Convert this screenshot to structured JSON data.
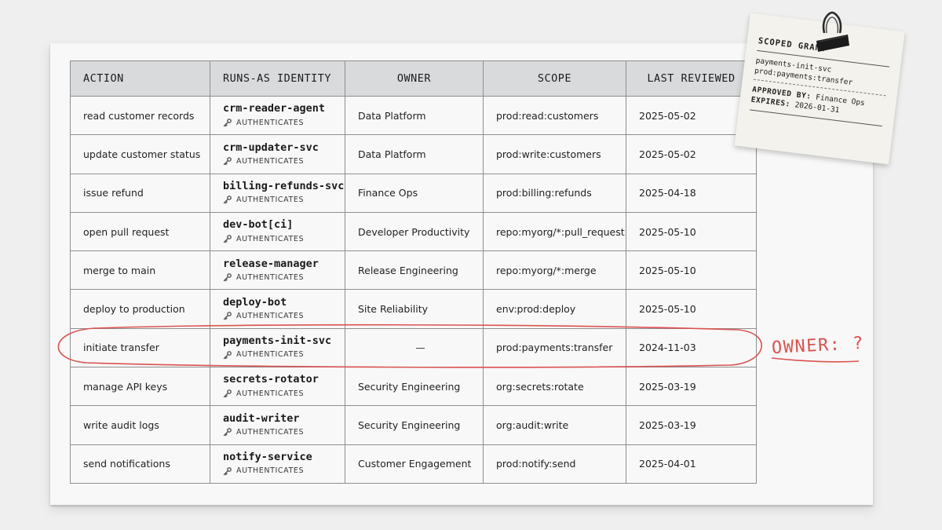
{
  "table": {
    "headers": {
      "action": "ACTION",
      "identity": "RUNS-AS IDENTITY",
      "owner": "OWNER",
      "scope": "SCOPE",
      "reviewed": "LAST REVIEWED"
    },
    "rows": [
      {
        "action": "read customer records",
        "identity": "crm-reader-agent",
        "auth": "AUTHENTICATES",
        "owner": "Data Platform",
        "scope": "prod:read:customers",
        "reviewed": "2025-05-02"
      },
      {
        "action": "update customer status",
        "identity": "crm-updater-svc",
        "auth": "AUTHENTICATES",
        "owner": "Data Platform",
        "scope": "prod:write:customers",
        "reviewed": "2025-05-02"
      },
      {
        "action": "issue refund",
        "identity": "billing-refunds-svc",
        "auth": "AUTHENTICATES",
        "owner": "Finance Ops",
        "scope": "prod:billing:refunds",
        "reviewed": "2025-04-18"
      },
      {
        "action": "open pull request",
        "identity": "dev-bot[ci]",
        "auth": "AUTHENTICATES",
        "owner": "Developer Productivity",
        "scope": "repo:myorg/*:pull_request",
        "reviewed": "2025-05-10"
      },
      {
        "action": "merge to main",
        "identity": "release-manager",
        "auth": "AUTHENTICATES",
        "owner": "Release Engineering",
        "scope": "repo:myorg/*:merge",
        "reviewed": "2025-05-10"
      },
      {
        "action": "deploy to production",
        "identity": "deploy-bot",
        "auth": "AUTHENTICATES",
        "owner": "Site Reliability",
        "scope": "env:prod:deploy",
        "reviewed": "2025-05-10"
      },
      {
        "action": "initiate transfer",
        "identity": "payments-init-svc",
        "auth": "AUTHENTICATES",
        "owner": "",
        "scope": "prod:payments:transfer",
        "reviewed": "2024-11-03"
      },
      {
        "action": "manage API keys",
        "identity": "secrets-rotator",
        "auth": "AUTHENTICATES",
        "owner": "Security Engineering",
        "scope": "org:secrets:rotate",
        "reviewed": "2025-03-19"
      },
      {
        "action": "write audit logs",
        "identity": "audit-writer",
        "auth": "AUTHENTICATES",
        "owner": "Security Engineering",
        "scope": "org:audit:write",
        "reviewed": "2025-03-19"
      },
      {
        "action": "send notifications",
        "identity": "notify-service",
        "auth": "AUTHENTICATES",
        "owner": "Customer Engagement",
        "scope": "prod:notify:send",
        "reviewed": "2025-04-01"
      }
    ]
  },
  "annotation": {
    "text": "OWNER: ?",
    "highlight_row": 6,
    "color": "#d95350"
  },
  "note": {
    "title": "SCOPED GRANT",
    "identity": "payments-init-svc",
    "scope": "prod:payments:transfer",
    "approved_label": "APPROVED BY:",
    "approved_value": "Finance Ops",
    "expires_label": "EXPIRES:",
    "expires_value": "2026-01-31"
  },
  "icons": {
    "auth": "key-icon",
    "clip": "binder-clip-icon",
    "missing_owner": "dash-icon"
  }
}
